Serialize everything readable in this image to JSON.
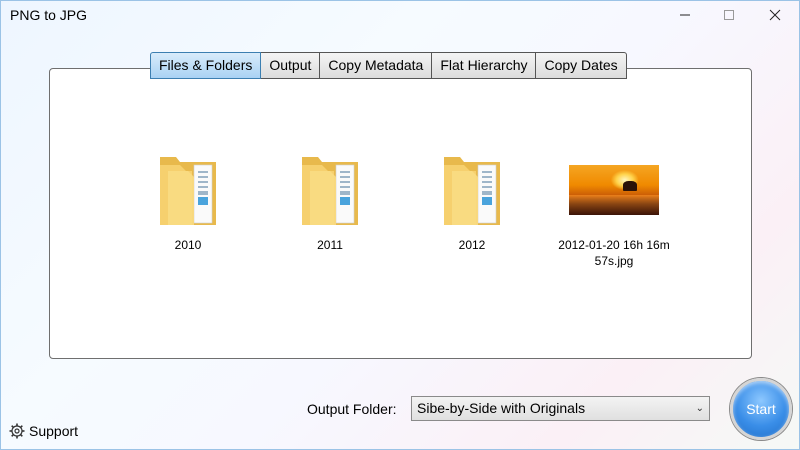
{
  "window": {
    "title": "PNG to JPG",
    "controls": {
      "minimize": "minimize-icon",
      "maximize": "maximize-icon",
      "close": "close-icon"
    }
  },
  "tabs": [
    {
      "label": "Files & Folders",
      "active": true
    },
    {
      "label": "Output",
      "active": false
    },
    {
      "label": "Copy Metadata",
      "active": false
    },
    {
      "label": "Flat Hierarchy",
      "active": false
    },
    {
      "label": "Copy Dates",
      "active": false
    }
  ],
  "items": [
    {
      "name": "2010",
      "kind": "folder"
    },
    {
      "name": "2011",
      "kind": "folder"
    },
    {
      "name": "2012",
      "kind": "folder"
    },
    {
      "name": "2012-01-20 16h 16m 57s.jpg",
      "kind": "image"
    }
  ],
  "bottom": {
    "support_label": "Support",
    "output_folder_label": "Output Folder:",
    "output_folder_value": "Sibe-by-Side with Originals",
    "start_label": "Start"
  },
  "colors": {
    "accent": "#3a8ee8",
    "tab_active": "#a9d2f3",
    "folder": "#f6d06e"
  }
}
